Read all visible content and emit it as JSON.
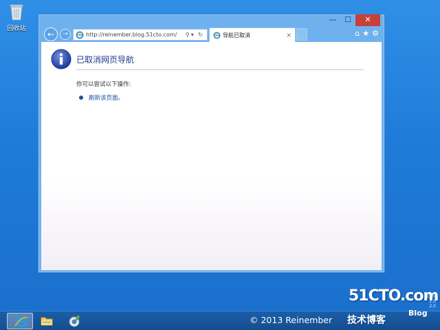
{
  "desktop": {
    "recycle_bin_label": "回收站"
  },
  "browser": {
    "address_url": "http://reinember.blog.51cto.com/",
    "tab_title": "导航已取消",
    "tab_close": "×",
    "back_glyph": "←",
    "forward_glyph": "→",
    "address_tools": "⚲▾ ↻",
    "window_controls": {
      "minimize": "—",
      "maximize": "☐",
      "close": "✕"
    },
    "toolbar_icons": {
      "home": "⌂",
      "favorites": "★",
      "settings": "⚙"
    }
  },
  "page": {
    "title": "已取消网页导航",
    "intro": "你可以尝试以下操作:",
    "refresh_link": "刷新该页面。"
  },
  "watermark": {
    "logo": "51CTO.com",
    "tech_blog": "技术博客",
    "blog": "Blog",
    "small_lines": [
      "com",
      "2.0",
      "2.0"
    ]
  },
  "taskbar": {
    "copyright": "© 2013 Reinember"
  },
  "colors": {
    "desktop_bg": "#1f7ad8",
    "link": "#1f4fa0",
    "title": "#1f3b8c",
    "close_button": "#c7403a"
  }
}
